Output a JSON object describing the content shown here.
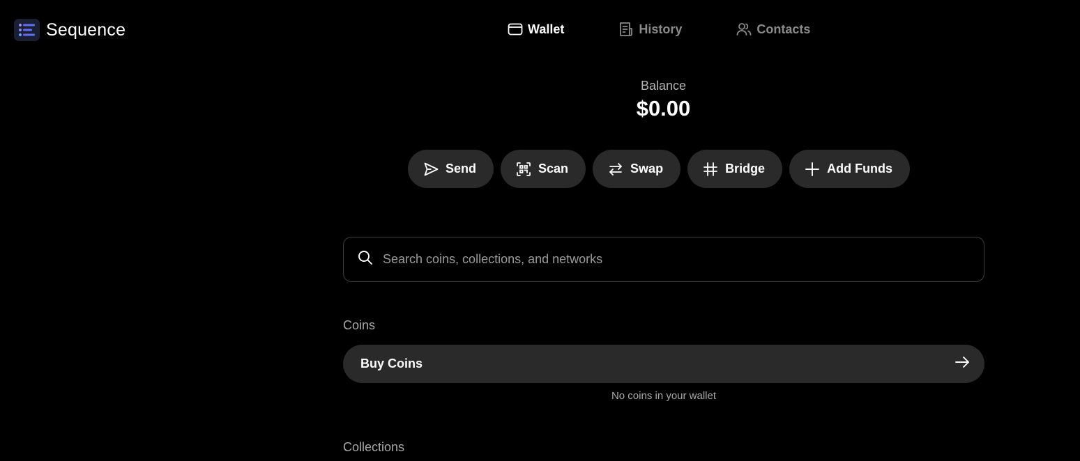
{
  "brand": {
    "name": "Sequence"
  },
  "nav": {
    "items": [
      {
        "label": "Wallet",
        "icon": "wallet-icon",
        "active": true
      },
      {
        "label": "History",
        "icon": "receipt-icon",
        "active": false
      },
      {
        "label": "Contacts",
        "icon": "users-icon",
        "active": false
      }
    ]
  },
  "balance": {
    "label": "Balance",
    "value": "$0.00"
  },
  "actions": [
    {
      "label": "Send",
      "icon": "send-icon"
    },
    {
      "label": "Scan",
      "icon": "scan-icon"
    },
    {
      "label": "Swap",
      "icon": "swap-icon"
    },
    {
      "label": "Bridge",
      "icon": "bridge-icon"
    },
    {
      "label": "Add Funds",
      "icon": "plus-icon"
    }
  ],
  "search": {
    "placeholder": "Search coins, collections, and networks",
    "value": ""
  },
  "coins": {
    "heading": "Coins",
    "buy_label": "Buy Coins",
    "empty_text": "No coins in your wallet"
  },
  "collections": {
    "heading": "Collections"
  },
  "colors": {
    "background": "#000000",
    "surface": "#2a2a2a",
    "muted_text": "#8a8a8a",
    "brand_gradient": [
      "#8b5cf6",
      "#3b82f6"
    ]
  }
}
